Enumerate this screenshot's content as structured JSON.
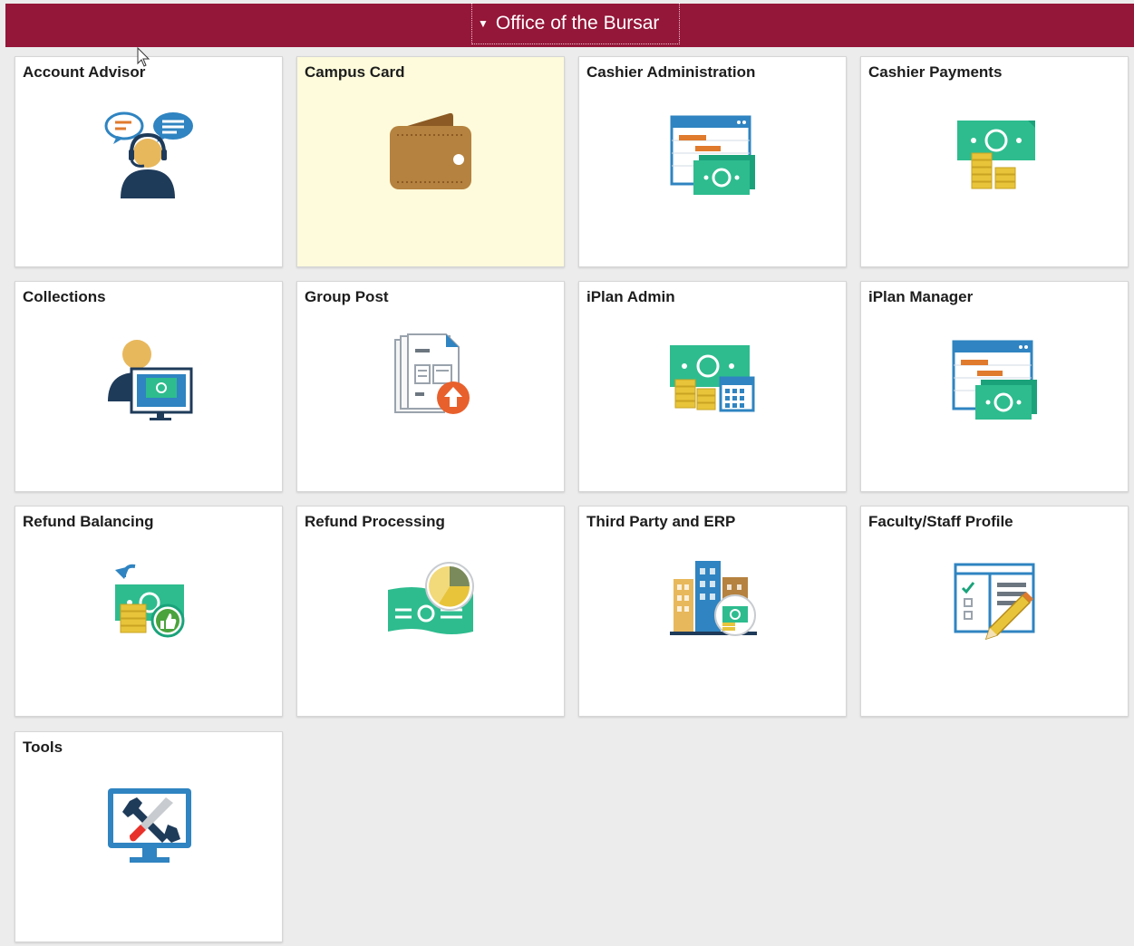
{
  "header": {
    "title": "Office of the Bursar",
    "caret": "▼",
    "color": "#941638"
  },
  "tiles": [
    {
      "label": "Account Advisor",
      "icon": "account-advisor-icon"
    },
    {
      "label": "Campus Card",
      "icon": "wallet-icon",
      "highlighted": true
    },
    {
      "label": "Cashier Administration",
      "icon": "calendar-money-icon"
    },
    {
      "label": "Cashier Payments",
      "icon": "cash-coins-icon"
    },
    {
      "label": "Collections",
      "icon": "collections-icon"
    },
    {
      "label": "Group Post",
      "icon": "document-upload-icon"
    },
    {
      "label": "iPlan Admin",
      "icon": "cash-calendar-icon"
    },
    {
      "label": "iPlan Manager",
      "icon": "calendar-money-icon"
    },
    {
      "label": "Refund Balancing",
      "icon": "refund-thumbs-up-icon"
    },
    {
      "label": "Refund Processing",
      "icon": "money-pie-chart-icon"
    },
    {
      "label": "Third Party and ERP",
      "icon": "buildings-money-icon"
    },
    {
      "label": "Faculty/Staff Profile",
      "icon": "form-pencil-icon"
    },
    {
      "label": "Tools",
      "icon": "monitor-tools-icon"
    }
  ]
}
